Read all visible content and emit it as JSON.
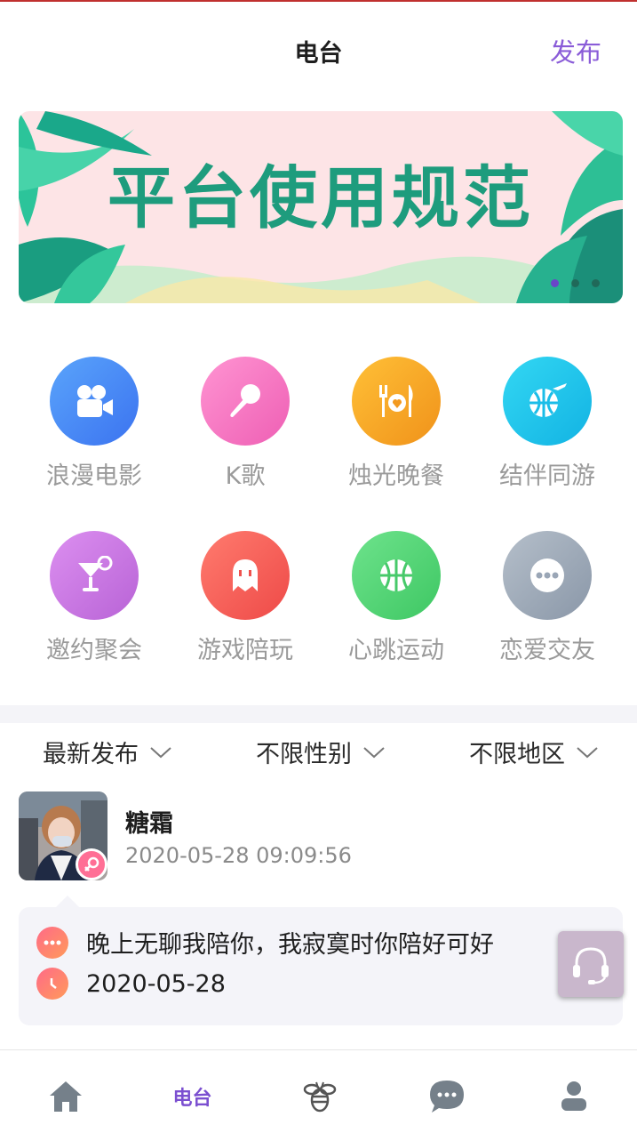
{
  "header": {
    "title": "电台",
    "publish_label": "发布"
  },
  "banner": {
    "text": "平台使用规范",
    "slide_count": 3,
    "active_slide": 1
  },
  "categories": [
    {
      "label": "浪漫电影",
      "icon": "movie-camera-icon",
      "color": "#4a8cf7"
    },
    {
      "label": "K歌",
      "icon": "microphone-icon",
      "color": "#f77fc4"
    },
    {
      "label": "烛光晚餐",
      "icon": "dinner-icon",
      "color": "#f6a21f"
    },
    {
      "label": "结伴同游",
      "icon": "travel-globe-icon",
      "color": "#1ec5ea"
    },
    {
      "label": "邀约聚会",
      "icon": "cocktail-icon",
      "color": "#c774e0"
    },
    {
      "label": "游戏陪玩",
      "icon": "game-ghost-icon",
      "color": "#f2645b"
    },
    {
      "label": "心跳运动",
      "icon": "basketball-icon",
      "color": "#4fd06f"
    },
    {
      "label": "恋爱交友",
      "icon": "more-chat-icon",
      "color": "#a0abb9"
    }
  ],
  "filters": [
    {
      "label": "最新发布"
    },
    {
      "label": "不限性别"
    },
    {
      "label": "不限地区"
    }
  ],
  "post": {
    "username": "糖霜",
    "time": "2020-05-28 09:09:56",
    "gender": "female",
    "content": "晚上无聊我陪你，我寂寞时你陪好可好",
    "date": "2020-05-28"
  },
  "tabbar": {
    "active_label": "电台",
    "items": [
      "home-icon",
      "电台",
      "bee-icon",
      "chat-icon",
      "profile-icon"
    ]
  }
}
